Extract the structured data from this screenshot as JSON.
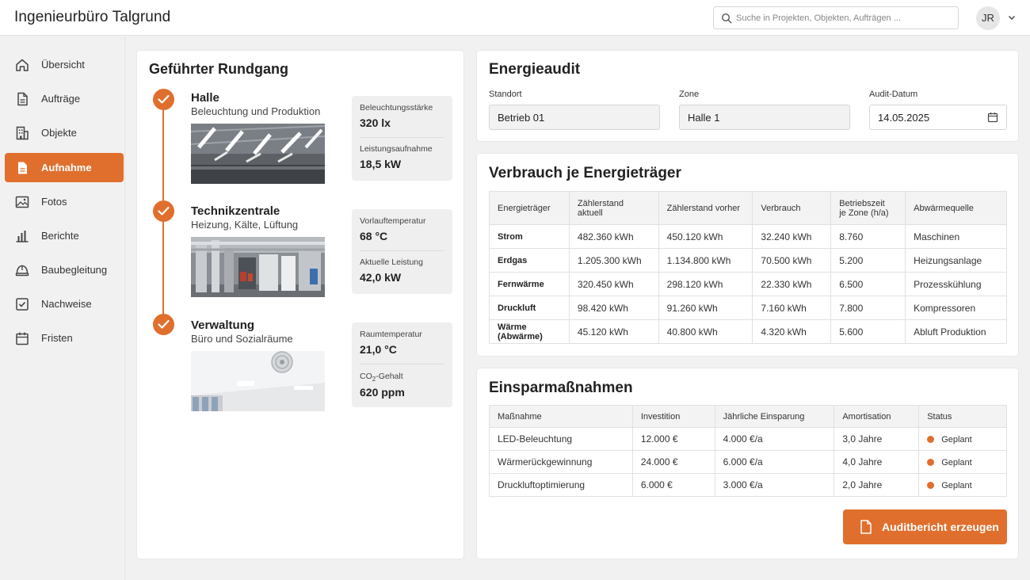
{
  "app": {
    "title": "Ingenieurbüro Talgrund",
    "search_placeholder": "Suche in Projekten, Objekten, Aufträgen ...",
    "user_initials": "JR"
  },
  "sidebar": {
    "items": [
      {
        "label": "Übersicht",
        "icon": "home-icon",
        "active": false
      },
      {
        "label": "Aufträge",
        "icon": "document-icon",
        "active": false
      },
      {
        "label": "Objekte",
        "icon": "building-icon",
        "active": false
      },
      {
        "label": "Aufnahme",
        "icon": "document-filled-icon",
        "active": true
      },
      {
        "label": "Fotos",
        "icon": "image-icon",
        "active": false
      },
      {
        "label": "Berichte",
        "icon": "bar-chart-icon",
        "active": false
      },
      {
        "label": "Baubegleitung",
        "icon": "helmet-icon",
        "active": false
      },
      {
        "label": "Nachweise",
        "icon": "checkbox-icon",
        "active": false
      },
      {
        "label": "Fristen",
        "icon": "calendar-icon",
        "active": false
      }
    ]
  },
  "tour": {
    "title": "Geführter Rundgang",
    "stops": [
      {
        "title": "Halle",
        "subtitle": "Beleuchtung und Produktion",
        "metric1_label": "Beleuchtungsstärke",
        "metric1_value": "320 lx",
        "metric2_label": "Leistungsaufnahme",
        "metric2_value": "18,5 kW"
      },
      {
        "title": "Technikzentrale",
        "subtitle": "Heizung, Kälte, Lüftung",
        "metric1_label": "Vorlauftemperatur",
        "metric1_value": "68 °C",
        "metric2_label": "Aktuelle Leistung",
        "metric2_value": "42,0 kW"
      },
      {
        "title": "Verwaltung",
        "subtitle": "Büro und Sozialräume",
        "metric1_label": "Raumtemperatur",
        "metric1_value": "21,0 °C",
        "metric2_label_pre": "CO",
        "metric2_label_sub": "2",
        "metric2_label_post": "-Gehalt",
        "metric2_value": "620 ppm"
      }
    ]
  },
  "audit": {
    "title": "Energieaudit",
    "standort_label": "Standort",
    "standort_value": "Betrieb 01",
    "zone_label": "Zone",
    "zone_value": "Halle 1",
    "date_label": "Audit-Datum",
    "date_value": "14.05.2025"
  },
  "consumption": {
    "title": "Verbrauch je Energieträger",
    "headers": [
      "Energieträger",
      "Zählerstand aktuell",
      "Zählerstand vorher",
      "Verbrauch",
      "Betriebszeit",
      "je Zone (h/a)",
      "Abwärmequelle"
    ],
    "rows": [
      [
        "Strom",
        "482.360 kWh",
        "450.120 kWh",
        "32.240 kWh",
        "8.760",
        "Maschinen"
      ],
      [
        "Erdgas",
        "1.205.300 kWh",
        "1.134.800 kWh",
        "70.500 kWh",
        "5.200",
        "Heizungsanlage"
      ],
      [
        "Fernwärme",
        "320.450 kWh",
        "298.120 kWh",
        "22.330 kWh",
        "6.500",
        "Prozesskühlung"
      ],
      [
        "Druckluft",
        "98.420 kWh",
        "91.260 kWh",
        "7.160 kWh",
        "7.800",
        "Kompressoren"
      ],
      [
        "Wärme (Abwärme)",
        "45.120 kWh",
        "40.800 kWh",
        "4.320 kWh",
        "5.600",
        "Abluft Produktion"
      ]
    ]
  },
  "measures": {
    "title": "Einsparmaßnahmen",
    "headers": [
      "Maßnahme",
      "Investition",
      "Jährliche Einsparung",
      "Amortisation",
      "Status"
    ],
    "rows": [
      [
        "LED-Beleuchtung",
        "12.000 €",
        "4.000 €/a",
        "3,0 Jahre",
        "Geplant"
      ],
      [
        "Wärmerückgewinnung",
        "24.000 €",
        "6.000 €/a",
        "4,0 Jahre",
        "Geplant"
      ],
      [
        "Druckluftoptimierung",
        "6.000 €",
        "3.000 €/a",
        "2,0 Jahre",
        "Geplant"
      ]
    ],
    "status_color": "#e06f2d",
    "button_label": "Auditbericht erzeugen"
  },
  "colors": {
    "accent": "#e06f2d"
  }
}
